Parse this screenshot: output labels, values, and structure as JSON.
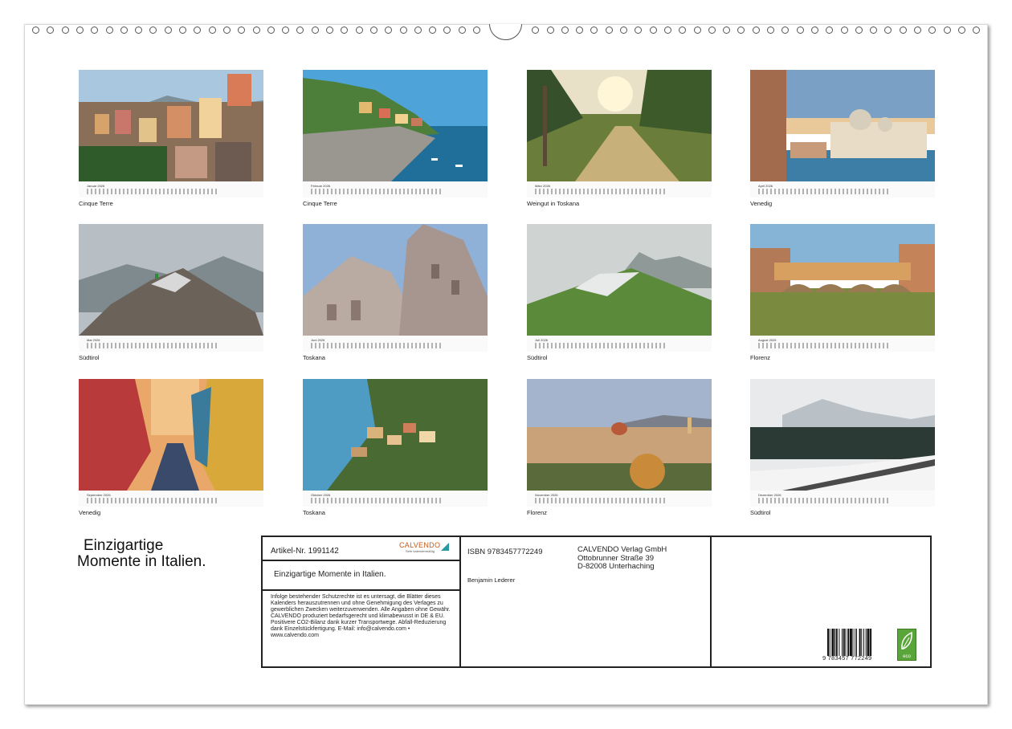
{
  "months": [
    {
      "name": "Januar 2026",
      "caption": "Cinque Terre"
    },
    {
      "name": "Februar 2026",
      "caption": "Cinque Terre"
    },
    {
      "name": "März 2026",
      "caption": "Weingut in Toskana"
    },
    {
      "name": "April 2026",
      "caption": "Venedig"
    },
    {
      "name": "Mai 2026",
      "caption": "Südtirol"
    },
    {
      "name": "Juni 2026",
      "caption": "Toskana"
    },
    {
      "name": "Juli 2026",
      "caption": "Südtirol"
    },
    {
      "name": "August 2026",
      "caption": "Florenz"
    },
    {
      "name": "September 2026",
      "caption": "Venedig"
    },
    {
      "name": "Oktober 2026",
      "caption": "Toskana"
    },
    {
      "name": "November 2026",
      "caption": "Florenz"
    },
    {
      "name": "Dezember 2026",
      "caption": "Südtirol"
    }
  ],
  "title": {
    "line1": "Einzigartige",
    "line2": "Momente in Italien."
  },
  "imprint": {
    "artikel": "Artikel-Nr. 1991142",
    "logo": "CALVENDO",
    "logo_sub": "Sehr kalendermäßig",
    "subtitle": "Einzigartige Momente in Italien.",
    "legal": "Infolge bestehender Schutzrechte ist es untersagt, die Blätter dieses Kalenders herauszutrennen und ohne Genehmigung des Verlages zu gewerblichen Zwecken weiterzuverwenden. Alle Angaben ohne Gewähr. CALVENDO produziert bedarfsgerecht und klimabewusst in DE & EU. Positivere CO2-Bilanz dank kurzer Transportwege. Abfall-Reduzierung dank Einzelstückfertigung. E-Mail: info@calvendo.com • www.calvendo.com",
    "isbn": "ISBN 9783457772249",
    "publisher_line1": "CALVENDO Verlag GmbH",
    "publisher_line2": "Ottobrunner Straße 39",
    "publisher_line3": "D-82008 Unterhaching",
    "author": "Benjamin Lederer",
    "barcode_number": "9 783457 772249",
    "eco_label": "eco"
  }
}
